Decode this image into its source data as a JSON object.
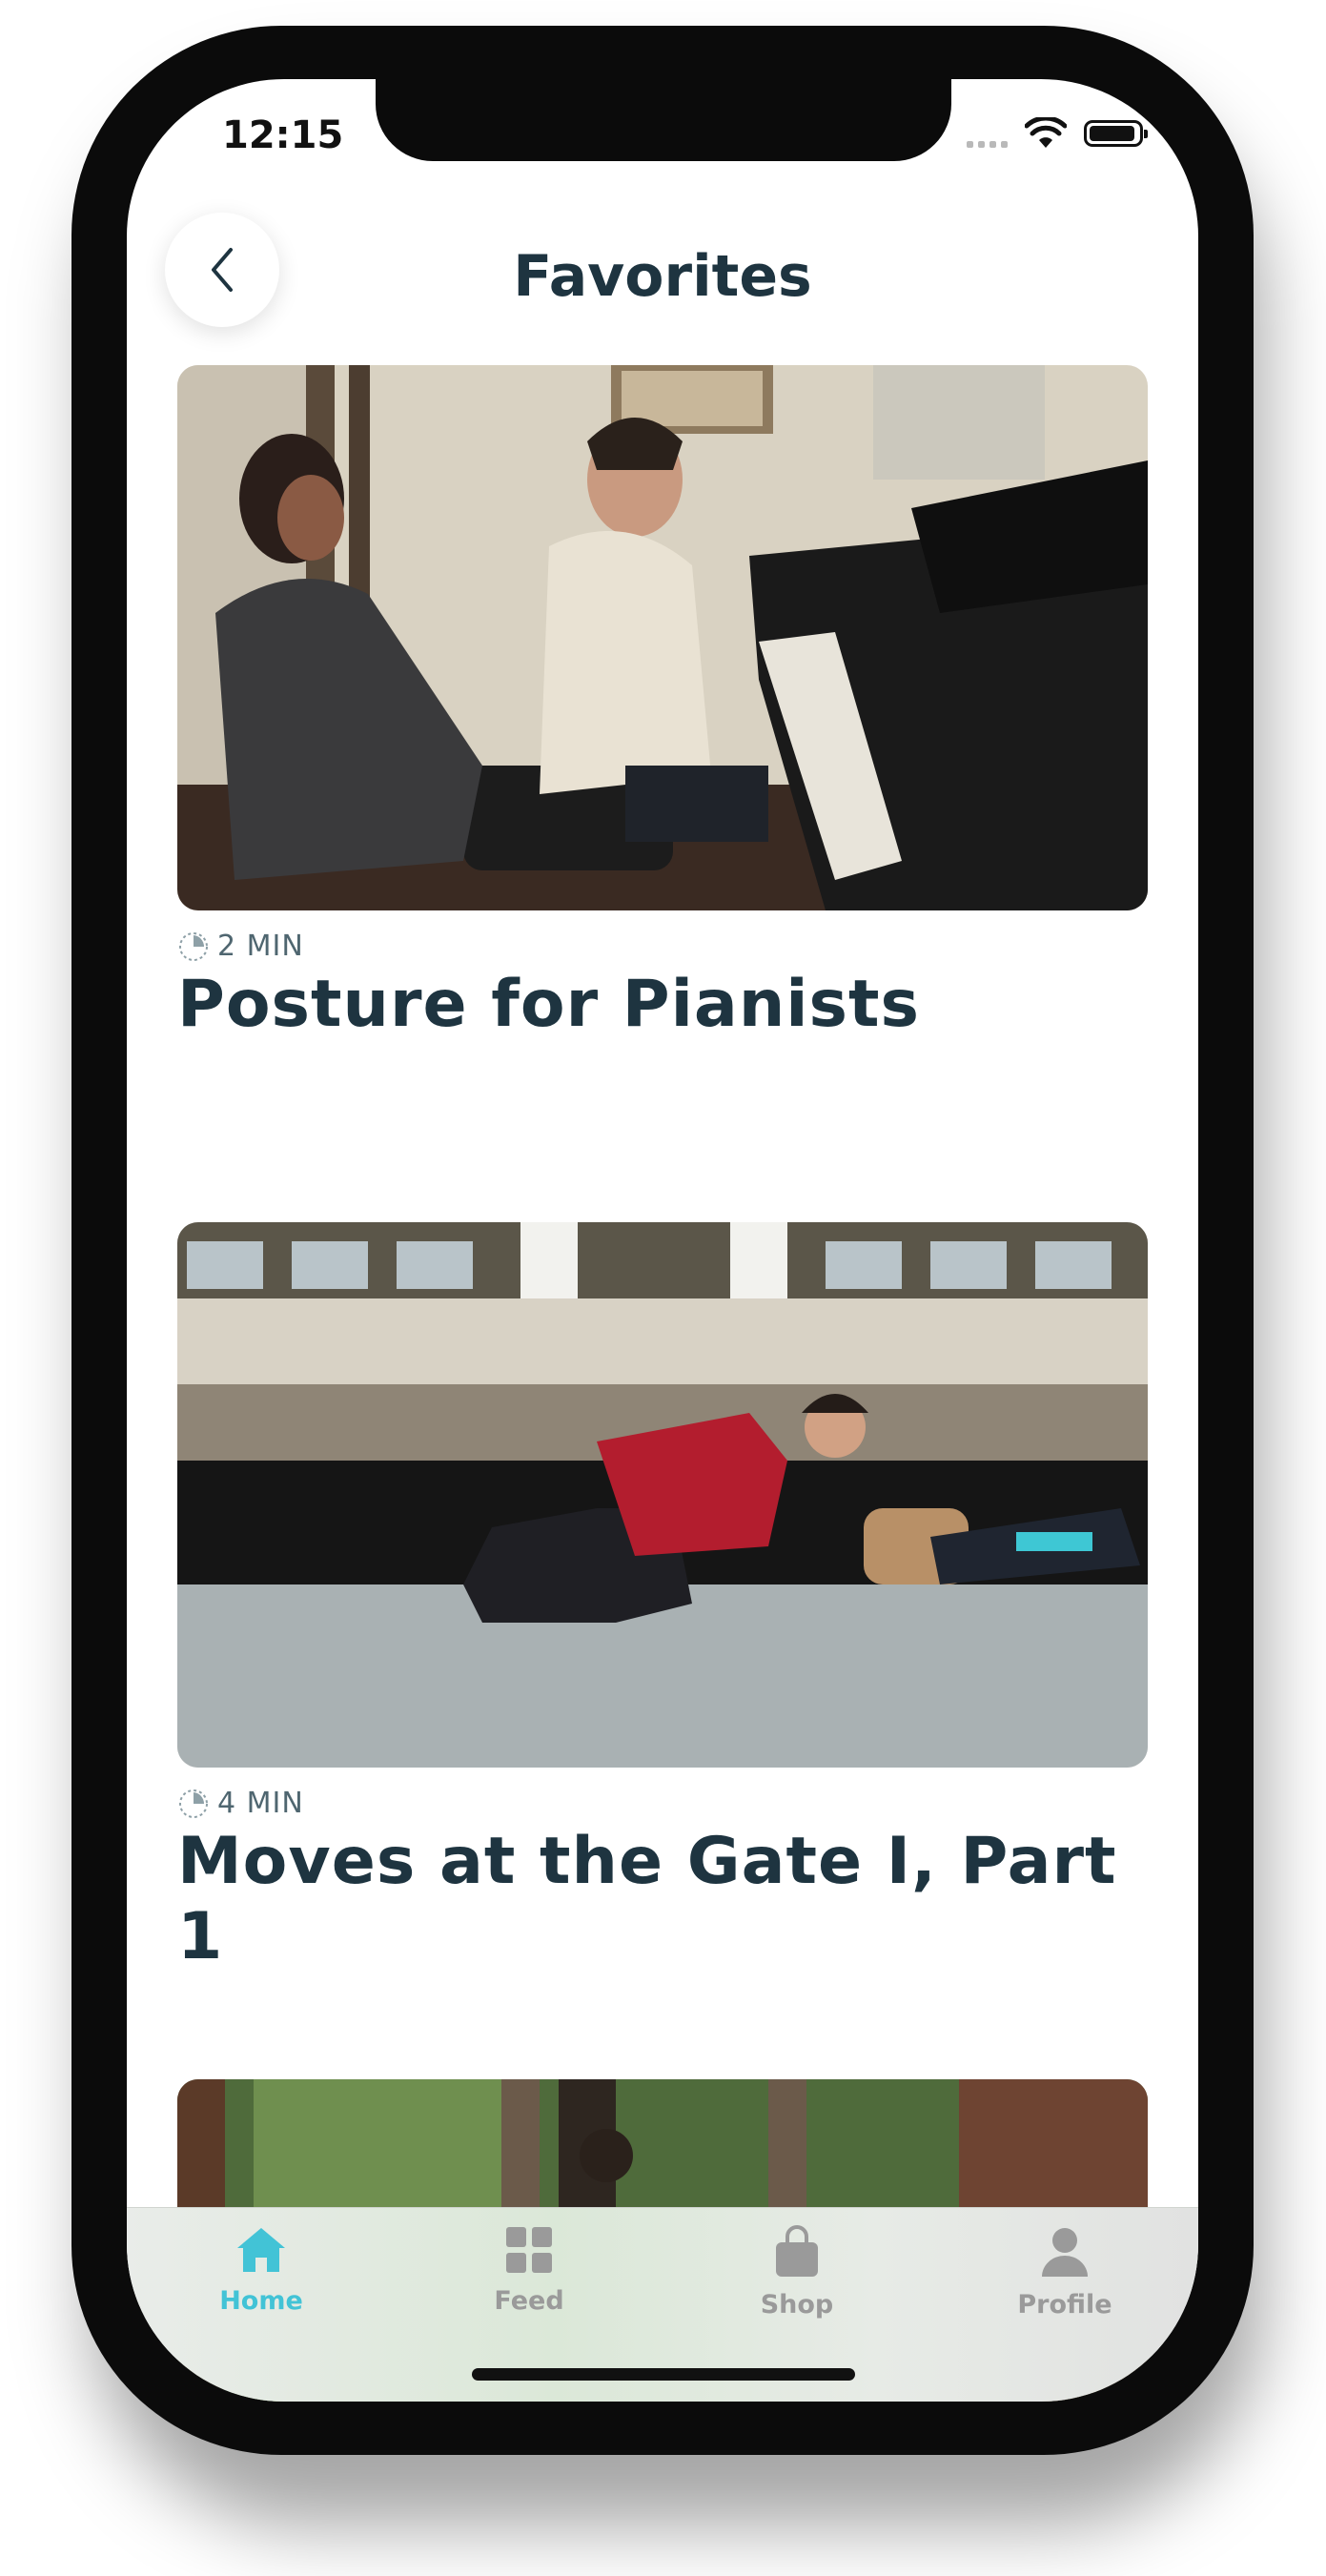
{
  "status_bar": {
    "time": "12:15"
  },
  "header": {
    "title": "Favorites"
  },
  "cards": [
    {
      "duration": "2 MIN",
      "title": "Posture for Pianists"
    },
    {
      "duration": "4 MIN",
      "title": "Moves at the Gate I, Part 1"
    },
    {
      "duration": "",
      "title": ""
    }
  ],
  "tabbar": {
    "items": [
      {
        "label": "Home",
        "icon": "home-icon",
        "active": true
      },
      {
        "label": "Feed",
        "icon": "grid-icon",
        "active": false
      },
      {
        "label": "Shop",
        "icon": "bag-icon",
        "active": false
      },
      {
        "label": "Profile",
        "icon": "person-icon",
        "active": false
      }
    ]
  },
  "colors": {
    "accent": "#42c3d6",
    "title_text": "#1e3440",
    "inactive_tab": "#9a9a9a"
  }
}
